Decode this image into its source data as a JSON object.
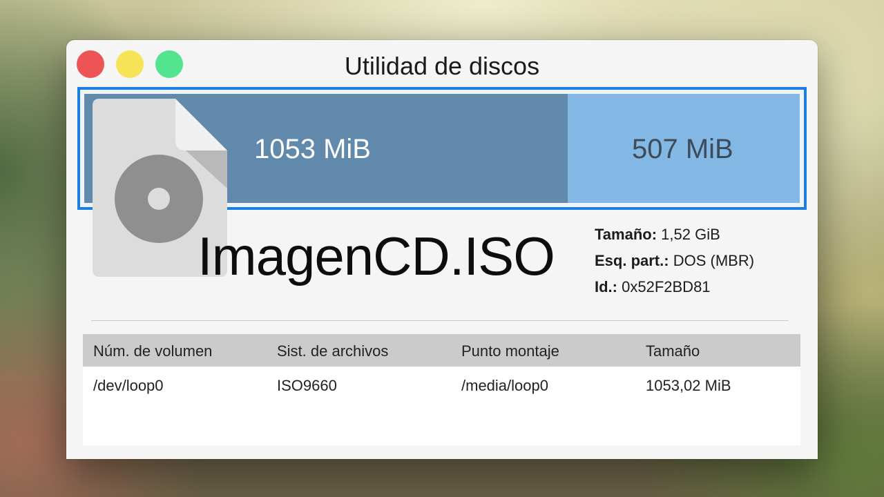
{
  "window": {
    "title": "Utilidad de discos"
  },
  "partitions": [
    {
      "label": "1053 MiB"
    },
    {
      "label": "507 MiB"
    }
  ],
  "disk": {
    "name": "ImagenCD.ISO",
    "icon": "iso-file-icon",
    "size_label": "Tamaño:",
    "size_value": "1,52 GiB",
    "scheme_label": "Esq. part.:",
    "scheme_value": "DOS (MBR)",
    "id_label": "Id.:",
    "id_value": "0x52F2BD81"
  },
  "table": {
    "headers": [
      "Núm. de volumen",
      "Sist. de archivos",
      "Punto montaje",
      "Tamaño"
    ],
    "rows": [
      [
        "/dev/loop0",
        "ISO9660",
        "/media/loop0",
        "1053,02 MiB"
      ]
    ]
  },
  "colors": {
    "selection_border": "#1a7fe0",
    "partition_1": "#6189ab",
    "partition_2": "#83b8e4",
    "close": "#ec5456",
    "minimize": "#f6e358",
    "maximize": "#54e38e"
  }
}
